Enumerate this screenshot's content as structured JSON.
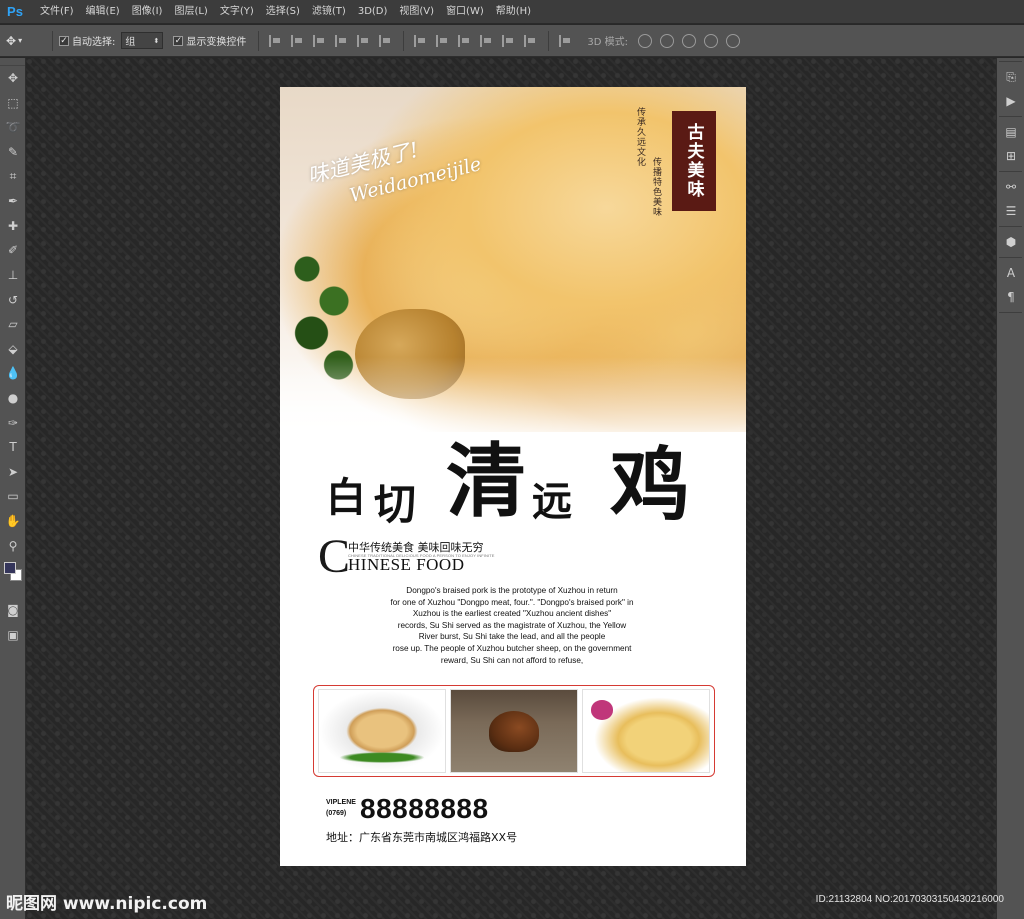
{
  "menubar": {
    "logo": "Ps",
    "items": [
      "文件(F)",
      "编辑(E)",
      "图像(I)",
      "图层(L)",
      "文字(Y)",
      "选择(S)",
      "滤镜(T)",
      "3D(D)",
      "视图(V)",
      "窗口(W)",
      "帮助(H)"
    ]
  },
  "options": {
    "auto_select_label": "自动选择:",
    "auto_select_value": "组",
    "show_transform_label": "显示变换控件",
    "mode3d_label": "3D 模式:"
  },
  "poster": {
    "script_cn": "味道美极了!",
    "script_en": "Weidaomeijile",
    "stamp": "古夫美味",
    "side_text_1": "传承久远文化",
    "side_text_2": "传播特色美味",
    "title": [
      "白",
      "切",
      "清",
      "远",
      "鸡"
    ],
    "sub_c": "C",
    "sub_cn": "中华传统美食  美味回味无穷",
    "sub_tiny": "CHINESE TRADITIONAL DELICIOUS FOOD   A PERSON TO ENJOY INFINITE",
    "sub_en": "HINESE FOOD",
    "paragraph": [
      "Dongpo's braised pork is the prototype of Xuzhou in return",
      "for one of Xuzhou \"Dongpo meat, four.\". \"Dongpo's braised pork\" in",
      "Xuzhou is the earliest created \"Xuzhou ancient dishes\"",
      "records, Su Shi served as the magistrate of Xuzhou, the Yellow",
      "River burst, Su Shi take the lead, and all the people",
      "rose up. The people of Xuzhou butcher sheep, on the government",
      "reward, Su Shi can not afford to refuse,"
    ],
    "viplene": "VIPLENE",
    "area_code": "(0769)",
    "phone": "88888888",
    "address": "地址：广东省东莞市南城区鸿福路XX号"
  },
  "watermark": {
    "logo": "昵图网 www.nipic.com",
    "id": "ID:21132804 NO:20170303150430216000"
  },
  "colors": {
    "ps_blue": "#2fa3f7",
    "stamp_bg": "#5a1a14",
    "photo_border": "#d53a33",
    "fg_color": "#35365b",
    "bg_color": "#ffffff"
  }
}
